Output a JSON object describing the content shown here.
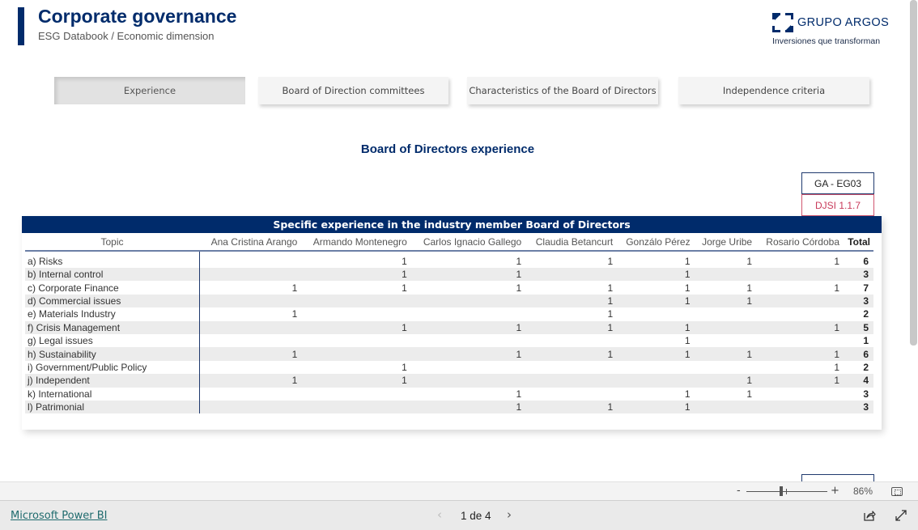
{
  "header": {
    "title": "Corporate governance",
    "subtitle": "ESG Databook / Economic dimension"
  },
  "logo": {
    "icon": "grupo-argos-bracket-mark",
    "name": "GRUPO ARGOS",
    "tagline": "Inversiones que transforman"
  },
  "nav": {
    "items": [
      {
        "label": "Experience",
        "active": true
      },
      {
        "label": "Board of Direction committees",
        "active": false
      },
      {
        "label": "Characteristics of the Board of Directors",
        "active": false
      },
      {
        "label": "Independence criteria",
        "active": false
      }
    ]
  },
  "section": {
    "title": "Board of Directors experience"
  },
  "codes": {
    "ga": "GA - EG03",
    "djsi": "DJSI 1.1.7"
  },
  "table": {
    "title": "Specific experience in the industry member Board of Directors",
    "columns": [
      "Topic",
      "Ana Cristina Arango",
      "Armando Montenegro",
      "Carlos Ignacio Gallego",
      "Claudia Betancurt",
      "Gonzálo Pérez",
      "Jorge Uribe",
      "Rosario Córdoba",
      "Total"
    ],
    "rows": [
      {
        "topic": "a) Risks",
        "values": [
          "",
          "1",
          "1",
          "1",
          "1",
          "1",
          "1"
        ],
        "total": "6"
      },
      {
        "topic": "b) Internal control",
        "values": [
          "",
          "1",
          "1",
          "",
          "1",
          "",
          ""
        ],
        "total": "3"
      },
      {
        "topic": "c) Corporate Finance",
        "values": [
          "1",
          "1",
          "1",
          "1",
          "1",
          "1",
          "1"
        ],
        "total": "7"
      },
      {
        "topic": "d) Commercial issues",
        "values": [
          "",
          "",
          "",
          "1",
          "1",
          "1",
          ""
        ],
        "total": "3"
      },
      {
        "topic": "e) Materials Industry",
        "values": [
          "1",
          "",
          "",
          "1",
          "",
          "",
          ""
        ],
        "total": "2"
      },
      {
        "topic": "f) Crisis Management",
        "values": [
          "",
          "1",
          "1",
          "1",
          "1",
          "",
          "1"
        ],
        "total": "5"
      },
      {
        "topic": "g) Legal issues",
        "values": [
          "",
          "",
          "",
          "",
          "1",
          "",
          ""
        ],
        "total": "1"
      },
      {
        "topic": "h) Sustainability",
        "values": [
          "1",
          "",
          "1",
          "1",
          "1",
          "1",
          "1"
        ],
        "total": "6"
      },
      {
        "topic": "i) Government/Public Policy",
        "values": [
          "",
          "1",
          "",
          "",
          "",
          "",
          "1"
        ],
        "total": "2"
      },
      {
        "topic": "j) Independent",
        "values": [
          "1",
          "1",
          "",
          "",
          "",
          "1",
          "1"
        ],
        "total": "4"
      },
      {
        "topic": "k) International",
        "values": [
          "",
          "",
          "1",
          "",
          "1",
          "1",
          ""
        ],
        "total": "3"
      },
      {
        "topic": "l) Patrimonial",
        "values": [
          "",
          "",
          "1",
          "1",
          "1",
          "",
          ""
        ],
        "total": "3"
      }
    ]
  },
  "zoom": {
    "minus": "-",
    "plus": "+",
    "level": "86%",
    "value_percent": 86
  },
  "footer": {
    "link": "Microsoft Power BI",
    "prev": "‹",
    "pager": "1 de 4",
    "next": "›",
    "current_page": 1,
    "total_pages": 4
  }
}
